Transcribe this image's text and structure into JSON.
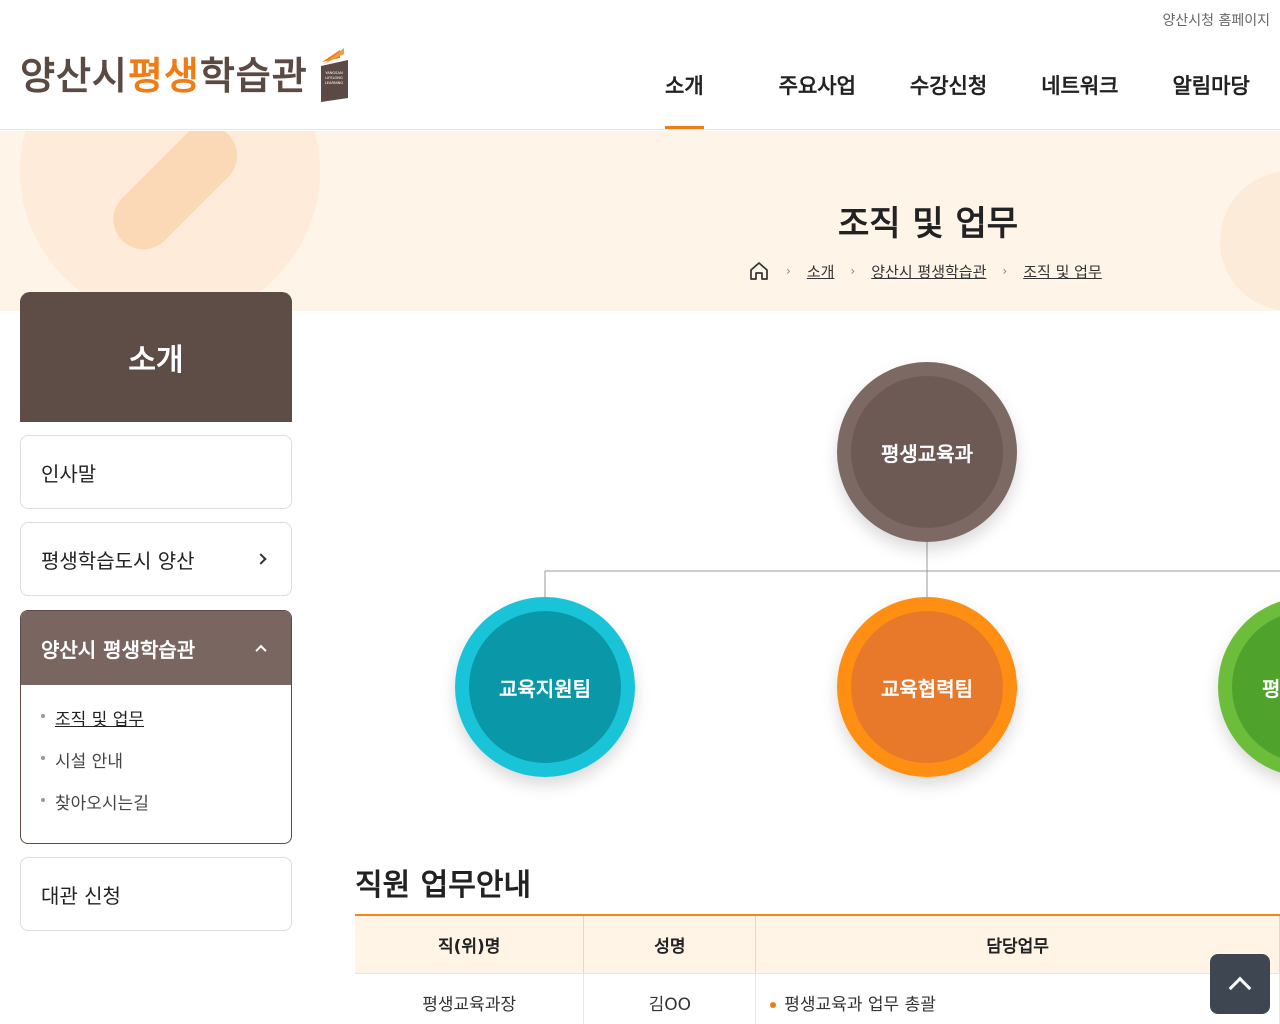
{
  "util": {
    "homepage_link": "양산시청 홈페이지"
  },
  "logo": {
    "part1": "양산시",
    "part2": "평생",
    "part3": "학습관",
    "book_caption": "YANGSAN LIFELONG LEARNING"
  },
  "gnb": {
    "items": [
      {
        "label": "소개",
        "active": true
      },
      {
        "label": "주요사업"
      },
      {
        "label": "수강신청"
      },
      {
        "label": "네트워크"
      },
      {
        "label": "알림마당"
      }
    ]
  },
  "page": {
    "title": "조직 및 업무"
  },
  "breadcrumb": {
    "home_icon": "home-icon",
    "items": [
      "소개",
      "양산시 평생학습관",
      "조직 및 업무"
    ]
  },
  "sidebar": {
    "title": "소개",
    "items": [
      {
        "label": "인사말"
      },
      {
        "label": "평생학습도시 양산"
      },
      {
        "label": "양산시 평생학습관",
        "open": true,
        "sub": [
          "조직 및 업무",
          "시설 안내",
          "찾아오시는길"
        ],
        "active_sub": "조직 및 업무"
      },
      {
        "label": "대관 신청"
      }
    ]
  },
  "org": {
    "root": {
      "label": "평생교육과",
      "color": "#6d5a55"
    },
    "teams": [
      {
        "label": "교육지원팀",
        "color": "#0a98a8"
      },
      {
        "label": "교육협력팀",
        "color": "#e8782a"
      },
      {
        "label": "평",
        "color": "#4fa22c"
      }
    ]
  },
  "staff": {
    "section_title": "직원 업무안내",
    "headers": [
      "직(위)명",
      "성명",
      "담당업무"
    ],
    "rows": [
      {
        "position": "평생교육과장",
        "name": "김OO",
        "duty": "평생교육과 업무 총괄"
      }
    ]
  },
  "colors": {
    "brand": "#5e4d47",
    "accent": "#ef7c14",
    "visual_bg": "#fff4e8"
  },
  "top_button": {
    "icon": "arrow-up-icon"
  }
}
